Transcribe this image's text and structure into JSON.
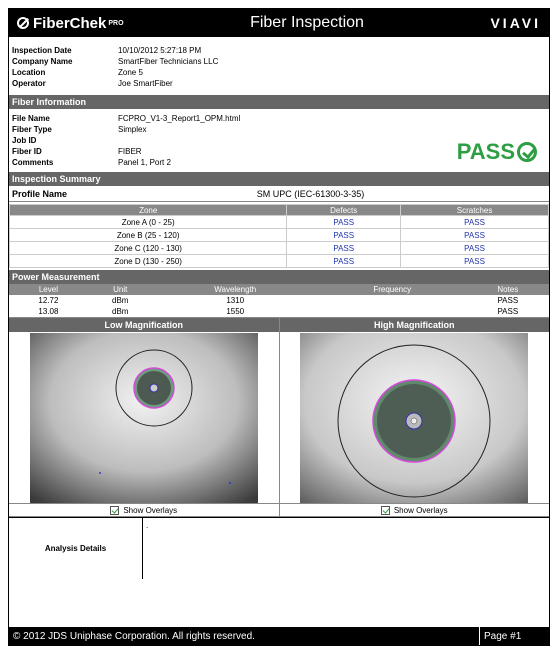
{
  "header": {
    "brand": "FiberChek",
    "brand_sup": "PRO",
    "title": "Fiber Inspection",
    "logo": "VIAVI"
  },
  "inspection": [
    {
      "label": "Inspection Date",
      "value": "10/10/2012 5:27:18 PM"
    },
    {
      "label": "Company Name",
      "value": "SmartFiber Technicians LLC"
    },
    {
      "label": "Location",
      "value": "Zone 5"
    },
    {
      "label": "Operator",
      "value": "Joe SmartFiber"
    }
  ],
  "fiber_info": {
    "title": "Fiber Information",
    "rows": [
      {
        "label": "File Name",
        "value": "FCPRO_V1-3_Report1_OPM.html"
      },
      {
        "label": "Fiber Type",
        "value": "Simplex"
      },
      {
        "label": "Job ID",
        "value": ""
      },
      {
        "label": "Fiber ID",
        "value": "FIBER"
      },
      {
        "label": "Comments",
        "value": "Panel 1, Port 2"
      }
    ],
    "result": "PASS"
  },
  "summary": {
    "title": "Inspection Summary",
    "profile_label": "Profile Name",
    "profile_value": "SM UPC (IEC-61300-3-35)",
    "headers": [
      "Zone",
      "Defects",
      "Scratches"
    ],
    "rows": [
      [
        "Zone A (0 - 25)",
        "PASS",
        "PASS"
      ],
      [
        "Zone B (25 - 120)",
        "PASS",
        "PASS"
      ],
      [
        "Zone C (120 - 130)",
        "PASS",
        "PASS"
      ],
      [
        "Zone D (130 - 250)",
        "PASS",
        "PASS"
      ]
    ]
  },
  "power": {
    "title": "Power Measurement",
    "headers": [
      "Level",
      "Unit",
      "Wavelength",
      "Frequency",
      "Notes"
    ],
    "rows": [
      [
        "12.72",
        "dBm",
        "1310",
        "",
        "PASS"
      ],
      [
        "13.08",
        "dBm",
        "1550",
        "",
        "PASS"
      ]
    ]
  },
  "images": {
    "low_title": "Low Magnification",
    "high_title": "High Magnification",
    "overlay_label": "Show Overlays"
  },
  "analysis": {
    "label": "Analysis Details",
    "value": "."
  },
  "footer": {
    "copyright": "© 2012 JDS Uniphase Corporation. All rights reserved.",
    "page": "Page #1"
  },
  "colors": {
    "pass_green": "#2e9e44",
    "pass_link": "#2233aa",
    "section": "#666666"
  }
}
